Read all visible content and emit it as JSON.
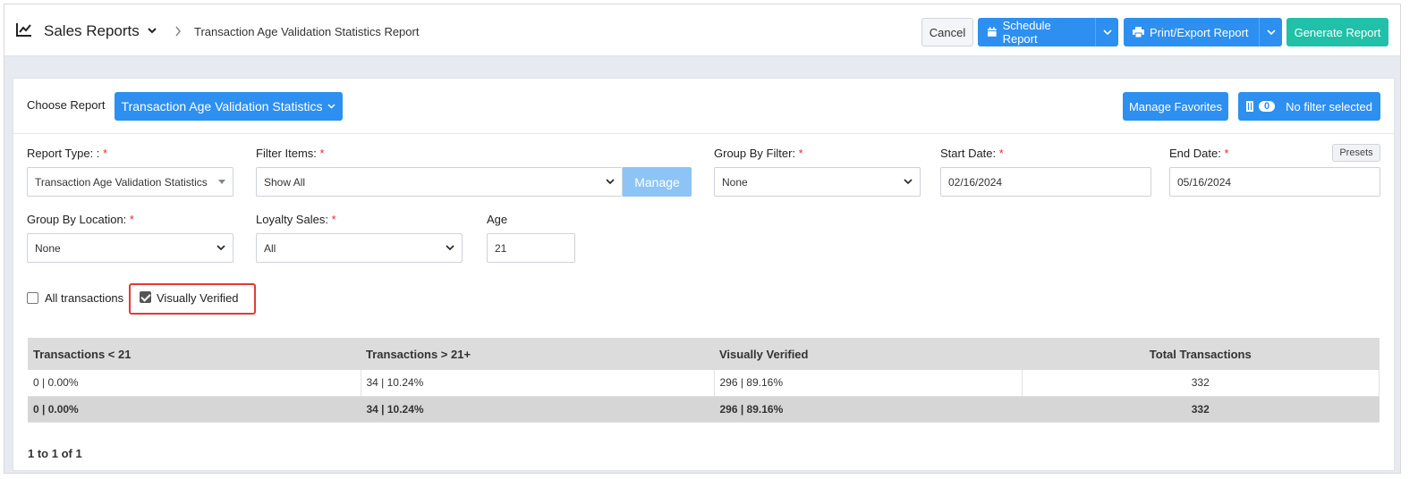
{
  "header": {
    "title": "Sales Reports",
    "breadcrumb": "Transaction Age Validation Statistics Report",
    "cancel": "Cancel",
    "schedule": "Schedule Report",
    "print_export": "Print/Export Report",
    "generate": "Generate Report"
  },
  "chooser": {
    "label": "Choose Report",
    "selected": "Transaction Age Validation Statistics",
    "manage_favorites": "Manage Favorites",
    "filter_count": "0",
    "filter_text": "No filter selected"
  },
  "filters": {
    "report_type": {
      "label": "Report Type: :",
      "value": "Transaction Age Validation Statistics"
    },
    "filter_items": {
      "label": "Filter Items:",
      "value": "Show All",
      "manage": "Manage"
    },
    "group_by_filter": {
      "label": "Group By Filter:",
      "value": "None"
    },
    "start_date": {
      "label": "Start Date:",
      "value": "02/16/2024"
    },
    "end_date": {
      "label": "End Date:",
      "value": "05/16/2024"
    },
    "presets": "Presets",
    "group_by_location": {
      "label": "Group By Location:",
      "value": "None"
    },
    "loyalty_sales": {
      "label": "Loyalty Sales:",
      "value": "All"
    },
    "age": {
      "label": "Age",
      "value": "21"
    },
    "required_mark": "*"
  },
  "options": {
    "all_transactions": {
      "label": "All transactions",
      "checked": false
    },
    "visually_verified": {
      "label": "Visually Verified",
      "checked": true
    }
  },
  "table": {
    "headers": [
      "Transactions < 21",
      "Transactions > 21+",
      "Visually Verified",
      "Total Transactions"
    ],
    "rows": [
      [
        "0 | 0.00%",
        "34 | 10.24%",
        "296 | 89.16%",
        "332"
      ]
    ],
    "total": [
      "0 | 0.00%",
      "34 | 10.24%",
      "296 | 89.16%",
      "332"
    ]
  },
  "pager": "1 to 1 of 1",
  "colors": {
    "primary": "#2d8ff0",
    "teal": "#21c0a8",
    "highlight": "#e53935"
  }
}
